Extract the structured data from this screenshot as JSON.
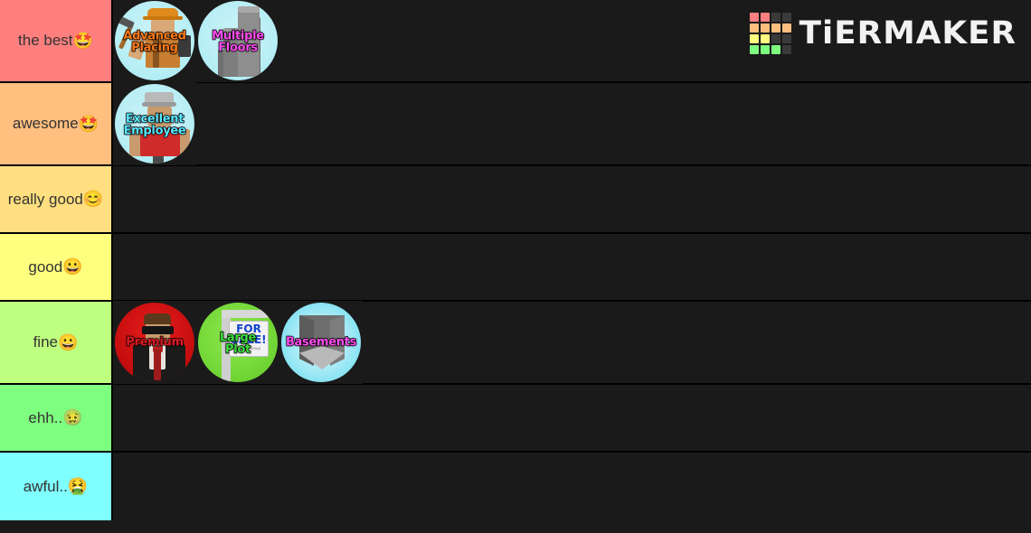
{
  "logo": {
    "wordmark": "TiERMAKER",
    "grid_colors": [
      "#ff7f7f",
      "#ff7f7f",
      "#3a3a3a",
      "#3a3a3a",
      "#ffbf7f",
      "#ffbf7f",
      "#ffbf7f",
      "#ffbf7f",
      "#ffff7f",
      "#ffff7f",
      "#3a3a3a",
      "#3a3a3a",
      "#7fff7f",
      "#7fff7f",
      "#7fff7f",
      "#3a3a3a"
    ]
  },
  "tiers": [
    {
      "label": "the best",
      "emoji": "🤩",
      "color": "#ff7f7f",
      "items": [
        {
          "name": "Advanced Placing",
          "caption_lines": [
            "Advanced",
            "Placing"
          ],
          "caption_theme": "cap-orange",
          "art": "advanced-placing"
        },
        {
          "name": "Multiple Floors",
          "caption_lines": [
            "Multiple",
            "Floors"
          ],
          "caption_theme": "cap-magenta",
          "art": "multiple-floors"
        }
      ]
    },
    {
      "label": "awesome",
      "emoji": "🤩",
      "color": "#ffbf7f",
      "items": [
        {
          "name": "Excellent Employee",
          "caption_lines": [
            "Excellent",
            "Employee"
          ],
          "caption_theme": "cap-cyan",
          "art": "excellent-employee"
        }
      ]
    },
    {
      "label": "really good",
      "emoji": "😊",
      "color": "#ffdf7f",
      "items": []
    },
    {
      "label": "good",
      "emoji": "😀",
      "color": "#ffff7f",
      "items": []
    },
    {
      "label": "fine",
      "emoji": "😀",
      "color": "#bfff7f",
      "items": [
        {
          "name": "Premium",
          "caption_lines": [
            "Premium"
          ],
          "caption_theme": "cap-red",
          "art": "premium"
        },
        {
          "name": "Large Plot",
          "caption_lines": [
            "Large",
            "Plot"
          ],
          "caption_theme": "cap-green",
          "art": "large-plot"
        },
        {
          "name": "Basements",
          "caption_lines": [
            "Basements"
          ],
          "caption_theme": "cap-magenta",
          "art": "basements"
        }
      ]
    },
    {
      "label": "ehh..",
      "emoji": "🤢",
      "color": "#7fff7f",
      "items": []
    },
    {
      "label": "awful..",
      "emoji": "🤮",
      "color": "#7fffff",
      "items": []
    }
  ],
  "sign_text": {
    "line1": "FOR",
    "line2": "SALE!",
    "line3": "Realty Group"
  }
}
